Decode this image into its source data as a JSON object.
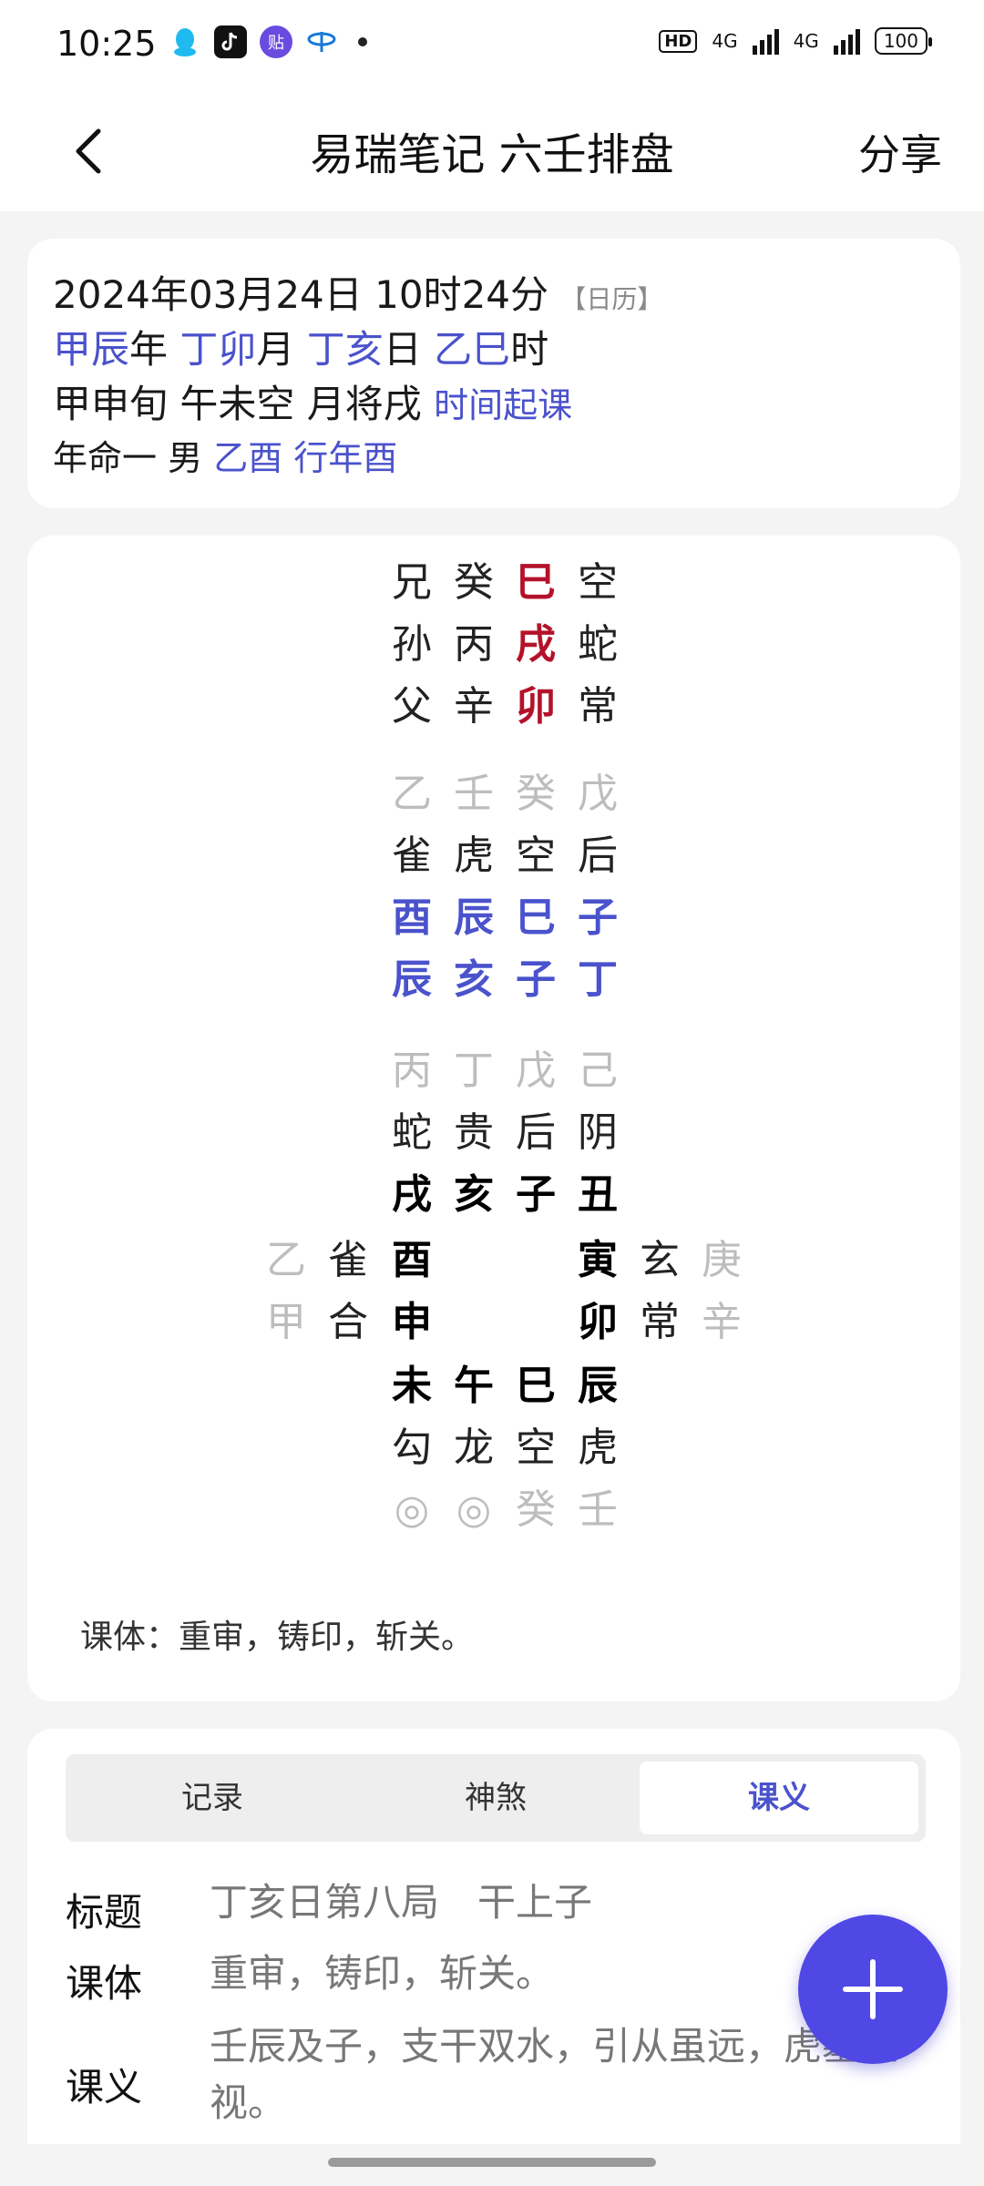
{
  "status_bar": {
    "time": "10:25",
    "app_icons": [
      "qq-icon",
      "tiktok-icon",
      "tieba-icon",
      "telecom-icon"
    ],
    "tieba_text": "贴",
    "hd_badge": "HD",
    "network_1": "4G",
    "network_2": "4G",
    "battery": "100"
  },
  "nav": {
    "title": "易瑞笔记 六壬排盘",
    "share_label": "分享"
  },
  "info": {
    "datetime": "2024年03月24日 10时24分",
    "calendar_tag": "【日历】",
    "year_gz": "甲辰",
    "year_suffix": "年",
    "month_gz": "丁卯",
    "month_suffix": "月",
    "day_gz": "丁亥",
    "day_suffix": "日",
    "hour_gz": "乙巳",
    "hour_suffix": "时",
    "xun_text": "甲申旬 午未空 月将戌",
    "time_start_link": "时间起课",
    "life_text": "年命一 男",
    "life_gz": "乙酉",
    "walk_year": "行年酉"
  },
  "chart": {
    "san_chuan": [
      [
        "兄",
        "癸",
        "巳",
        "空"
      ],
      [
        "孙",
        "丙",
        "戌",
        "蛇"
      ],
      [
        "父",
        "辛",
        "卯",
        "常"
      ]
    ],
    "si_ke": {
      "dun": [
        "乙",
        "壬",
        "癸",
        "戊"
      ],
      "jiang": [
        "雀",
        "虎",
        "空",
        "后"
      ],
      "upper": [
        "酉",
        "辰",
        "巳",
        "子"
      ],
      "lower": [
        "辰",
        "亥",
        "子",
        "丁"
      ]
    },
    "tian_di": {
      "top_dun": [
        "丙",
        "丁",
        "戊",
        "己"
      ],
      "top_jiang": [
        "蛇",
        "贵",
        "后",
        "阴"
      ],
      "top_branch": [
        "戌",
        "亥",
        "子",
        "丑"
      ],
      "left_rows": [
        {
          "dun": "乙",
          "jiang": "雀",
          "branch": "酉"
        },
        {
          "dun": "甲",
          "jiang": "合",
          "branch": "申"
        }
      ],
      "right_rows": [
        {
          "branch": "寅",
          "jiang": "玄",
          "dun": "庚"
        },
        {
          "branch": "卯",
          "jiang": "常",
          "dun": "辛"
        }
      ],
      "bottom_branch": [
        "未",
        "午",
        "巳",
        "辰"
      ],
      "bottom_jiang": [
        "勾",
        "龙",
        "空",
        "虎"
      ],
      "bottom_dun": [
        "◎",
        "◎",
        "癸",
        "壬"
      ]
    },
    "keti_line": "课体：重审，铸印，斩关。"
  },
  "bottom": {
    "tabs": [
      "记录",
      "神煞",
      "课义"
    ],
    "active_tab": 2,
    "rows": [
      {
        "label": "标题",
        "value": "丁亥日第八局　干上子"
      },
      {
        "label": "课体",
        "value": "重审，铸印，斩关。"
      },
      {
        "label": "课义",
        "value": "壬辰及子，支干双水，引从虽远，虎墓宜视。"
      }
    ]
  },
  "colors": {
    "accent": "#4a52cc",
    "red": "#b4122a",
    "fab": "#5048e5"
  }
}
